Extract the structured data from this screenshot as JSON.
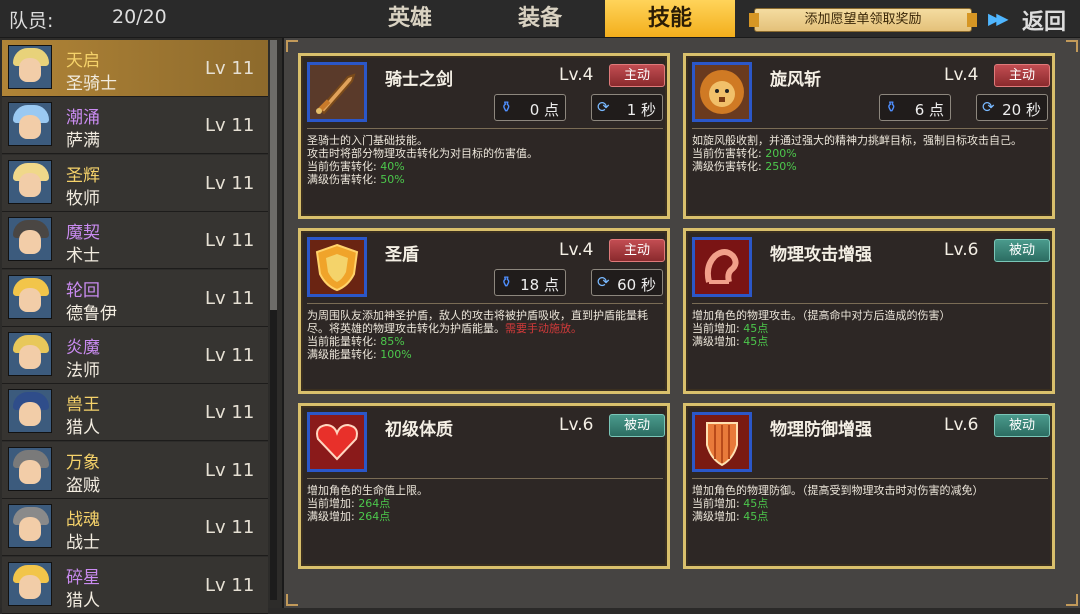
{
  "header": {
    "members_label": "队员:",
    "members_count": "20/20",
    "tabs": [
      {
        "label": "英雄",
        "active": false
      },
      {
        "label": "装备",
        "active": false
      },
      {
        "label": "技能",
        "active": true
      }
    ],
    "wish_button": "添加愿望单领取奖励",
    "forward_icon": "double-chevron-right-icon",
    "back_label": "返回"
  },
  "colors": {
    "accent": "#f3ae1c",
    "card_border": "#d9c06c",
    "active_badge": "#b13f44",
    "passive_badge": "#3f8a7d",
    "value_green": "#4cc84c",
    "warn_red": "#d23a3a"
  },
  "heroes": [
    {
      "name": "天启",
      "class": "圣骑士",
      "level": "Lv 11",
      "name_color": "#f5d26a",
      "selected": true,
      "hair": "#e8d27a"
    },
    {
      "name": "潮涌",
      "class": "萨满",
      "level": "Lv 11",
      "name_color": "#c98bf0",
      "selected": false,
      "hair": "#9ac9f2"
    },
    {
      "name": "圣辉",
      "class": "牧师",
      "level": "Lv 11",
      "name_color": "#f5d26a",
      "selected": false,
      "hair": "#f0d88a"
    },
    {
      "name": "魔契",
      "class": "术士",
      "level": "Lv 11",
      "name_color": "#c98bf0",
      "selected": false,
      "hair": "#4a4643"
    },
    {
      "name": "轮回",
      "class": "德鲁伊",
      "level": "Lv 11",
      "name_color": "#c98bf0",
      "selected": false,
      "hair": "#f2c54a"
    },
    {
      "name": "炎魔",
      "class": "法师",
      "level": "Lv 11",
      "name_color": "#c98bf0",
      "selected": false,
      "hair": "#e8c85a"
    },
    {
      "name": "兽王",
      "class": "猎人",
      "level": "Lv 11",
      "name_color": "#f5d26a",
      "selected": false,
      "hair": "#2f4d8a"
    },
    {
      "name": "万象",
      "class": "盗贼",
      "level": "Lv 11",
      "name_color": "#f5d26a",
      "selected": false,
      "hair": "#7a7a7a"
    },
    {
      "name": "战魂",
      "class": "战士",
      "level": "Lv 11",
      "name_color": "#f5d26a",
      "selected": false,
      "hair": "#8a8a8a"
    },
    {
      "name": "碎星",
      "class": "猎人",
      "level": "Lv 11",
      "name_color": "#c98bf0",
      "selected": false,
      "hair": "#f2c54a"
    }
  ],
  "skills": [
    {
      "name": "骑士之剑",
      "level": "Lv.4",
      "type": "主动",
      "kind": "active",
      "icon": "sword-icon",
      "mana": "0 点",
      "cooldown": "1 秒",
      "desc": [
        "圣骑士的入门基础技能。",
        "攻击时将部分物理攻击转化为对目标的伤害值。"
      ],
      "warn": "",
      "rows": [
        {
          "label": "当前伤害转化:",
          "value": "40%"
        },
        {
          "label": "满级伤害转化:",
          "value": "50%"
        }
      ]
    },
    {
      "name": "旋风斩",
      "level": "Lv.4",
      "type": "主动",
      "kind": "active",
      "icon": "lion-icon",
      "mana": "6 点",
      "cooldown": "20 秒",
      "desc": [
        "如旋风般收割，并通过强大的精神力挑衅目标，强制目标攻击自己。"
      ],
      "warn": "",
      "rows": [
        {
          "label": "当前伤害转化:",
          "value": "200%"
        },
        {
          "label": "满级伤害转化:",
          "value": "250%"
        }
      ]
    },
    {
      "name": "圣盾",
      "level": "Lv.4",
      "type": "主动",
      "kind": "active",
      "icon": "shield-icon",
      "mana": "18 点",
      "cooldown": "60 秒",
      "desc": [
        "为周围队友添加神圣护盾，敌人的攻击将被护盾吸收，直到护盾能量耗尽。将英雄的物理攻击转化为护盾能量。"
      ],
      "warn": "需要手动施放。",
      "rows": [
        {
          "label": "当前能量转化:",
          "value": "85%"
        },
        {
          "label": "满级能量转化:",
          "value": "100%"
        }
      ]
    },
    {
      "name": "物理攻击增强",
      "level": "Lv.6",
      "type": "被动",
      "kind": "passive",
      "icon": "muscle-arm-icon",
      "mana": "",
      "cooldown": "",
      "desc": [
        "增加角色的物理攻击。（提高命中对方后造成的伤害）"
      ],
      "warn": "",
      "rows": [
        {
          "label": "当前增加:",
          "value": "45点"
        },
        {
          "label": "满级增加:",
          "value": "45点"
        }
      ]
    },
    {
      "name": "初级体质",
      "level": "Lv.6",
      "type": "被动",
      "kind": "passive",
      "icon": "heart-icon",
      "mana": "",
      "cooldown": "",
      "desc": [
        "增加角色的生命值上限。"
      ],
      "warn": "",
      "rows": [
        {
          "label": "当前增加:",
          "value": "264点"
        },
        {
          "label": "满级增加:",
          "value": "264点"
        }
      ]
    },
    {
      "name": "物理防御增强",
      "level": "Lv.6",
      "type": "被动",
      "kind": "passive",
      "icon": "armor-shield-icon",
      "mana": "",
      "cooldown": "",
      "desc": [
        "增加角色的物理防御。（提高受到物理攻击时对伤害的减免）"
      ],
      "warn": "",
      "rows": [
        {
          "label": "当前增加:",
          "value": "45点"
        },
        {
          "label": "满级增加:",
          "value": "45点"
        }
      ]
    }
  ]
}
